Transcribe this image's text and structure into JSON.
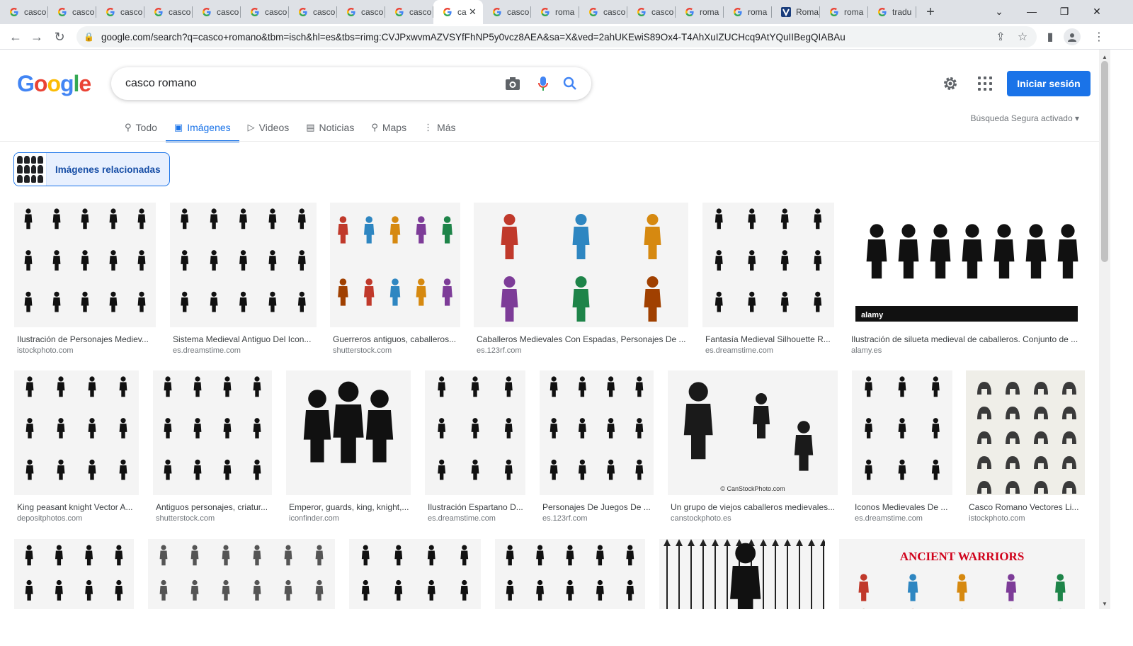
{
  "browser": {
    "tabs": [
      {
        "title": "casco",
        "icon": "google-g-icon"
      },
      {
        "title": "casco",
        "icon": "google-g-icon"
      },
      {
        "title": "casco",
        "icon": "google-g-icon"
      },
      {
        "title": "casco",
        "icon": "google-g-icon"
      },
      {
        "title": "casco",
        "icon": "google-g-icon"
      },
      {
        "title": "casco",
        "icon": "google-g-icon"
      },
      {
        "title": "casco",
        "icon": "google-g-icon"
      },
      {
        "title": "casco",
        "icon": "google-g-icon"
      },
      {
        "title": "casco",
        "icon": "google-g-icon"
      },
      {
        "title": "ca",
        "icon": "google-g-icon",
        "active": true
      },
      {
        "title": "casco",
        "icon": "google-g-icon"
      },
      {
        "title": "roma",
        "icon": "google-g-icon"
      },
      {
        "title": "casco",
        "icon": "google-g-icon"
      },
      {
        "title": "casco",
        "icon": "google-g-icon"
      },
      {
        "title": "roma",
        "icon": "google-g-icon"
      },
      {
        "title": "roma",
        "icon": "google-g-icon"
      },
      {
        "title": "Roma",
        "icon": "v-site-icon"
      },
      {
        "title": "roma",
        "icon": "google-g-icon"
      },
      {
        "title": "tradu",
        "icon": "google-g-icon"
      }
    ],
    "url": "google.com/search?q=casco+romano&tbm=isch&hl=es&tbs=rimg:CVJPxwvmAZVSYfFhNP5y0vcz8AEA&sa=X&ved=2ahUKEwiS89Ox4-T4AhXuIZUCHcq9AtYQuIIBegQIABAu"
  },
  "google": {
    "logo_letters": [
      {
        "ch": "G",
        "color": "#4285F4"
      },
      {
        "ch": "o",
        "color": "#EA4335"
      },
      {
        "ch": "o",
        "color": "#FBBC05"
      },
      {
        "ch": "g",
        "color": "#4285F4"
      },
      {
        "ch": "l",
        "color": "#34A853"
      },
      {
        "ch": "e",
        "color": "#EA4335"
      }
    ],
    "query": "casco romano",
    "signin_label": "Iniciar sesión",
    "safesearch": "Búsqueda Segura activado ▾",
    "nav": [
      {
        "label": "Todo",
        "icon": "search-icon"
      },
      {
        "label": "Imágenes",
        "icon": "image-icon",
        "active": true
      },
      {
        "label": "Videos",
        "icon": "play-icon"
      },
      {
        "label": "Noticias",
        "icon": "news-icon"
      },
      {
        "label": "Maps",
        "icon": "map-pin-icon"
      },
      {
        "label": "Más",
        "icon": "more-vert-icon"
      }
    ],
    "related_label": "Imágenes relacionadas"
  },
  "results": [
    {
      "caption": "Ilustración de Personajes Mediev...",
      "source": "istockphoto.com",
      "style": "silhouettes"
    },
    {
      "caption": "Sistema Medieval Antiguo Del Icon...",
      "source": "es.dreamstime.com",
      "style": "silhouettes"
    },
    {
      "caption": "Guerreros antiguos, caballeros...",
      "source": "shutterstock.com",
      "style": "color-riders"
    },
    {
      "caption": "Caballeros Medievales Con Espadas, Personajes De ...",
      "source": "es.123rf.com",
      "style": "color-knights"
    },
    {
      "caption": "Fantasía Medieval Silhouette R...",
      "source": "es.dreamstime.com",
      "style": "silhouettes"
    },
    {
      "caption": "Ilustración de silueta medieval de caballeros. Conjunto de ...",
      "source": "alamy.es",
      "style": "large-silhouettes"
    },
    {
      "caption": "King peasant knight Vector A...",
      "source": "depositphotos.com",
      "style": "silhouettes"
    },
    {
      "caption": "Antiguos personajes, criatur...",
      "source": "shutterstock.com",
      "style": "silhouettes"
    },
    {
      "caption": "Emperor, guards, king, knight,...",
      "source": "iconfinder.com",
      "style": "big-icon"
    },
    {
      "caption": "Ilustración Espartano D...",
      "source": "es.dreamstime.com",
      "style": "silhouettes"
    },
    {
      "caption": "Personajes De Juegos De ...",
      "source": "es.123rf.com",
      "style": "silhouettes"
    },
    {
      "caption": "Un grupo de viejos caballeros medievales...",
      "source": "canstockphoto.es",
      "style": "armor"
    },
    {
      "caption": "Iconos Medievales De ...",
      "source": "es.dreamstime.com",
      "style": "silhouettes"
    },
    {
      "caption": "Casco Romano Vectores Li...",
      "source": "istockphoto.com",
      "style": "helmets"
    },
    {
      "caption": "",
      "source": "",
      "style": "silhouettes"
    },
    {
      "caption": "",
      "source": "",
      "style": "sketch"
    },
    {
      "caption": "",
      "source": "",
      "style": "silhouettes"
    },
    {
      "caption": "",
      "source": "",
      "style": "silhouettes"
    },
    {
      "caption": "",
      "source": "",
      "style": "weapons"
    },
    {
      "caption": "",
      "source": "",
      "style": "ancient-warriors",
      "banner": "ANCIENT WARRIORS"
    }
  ]
}
